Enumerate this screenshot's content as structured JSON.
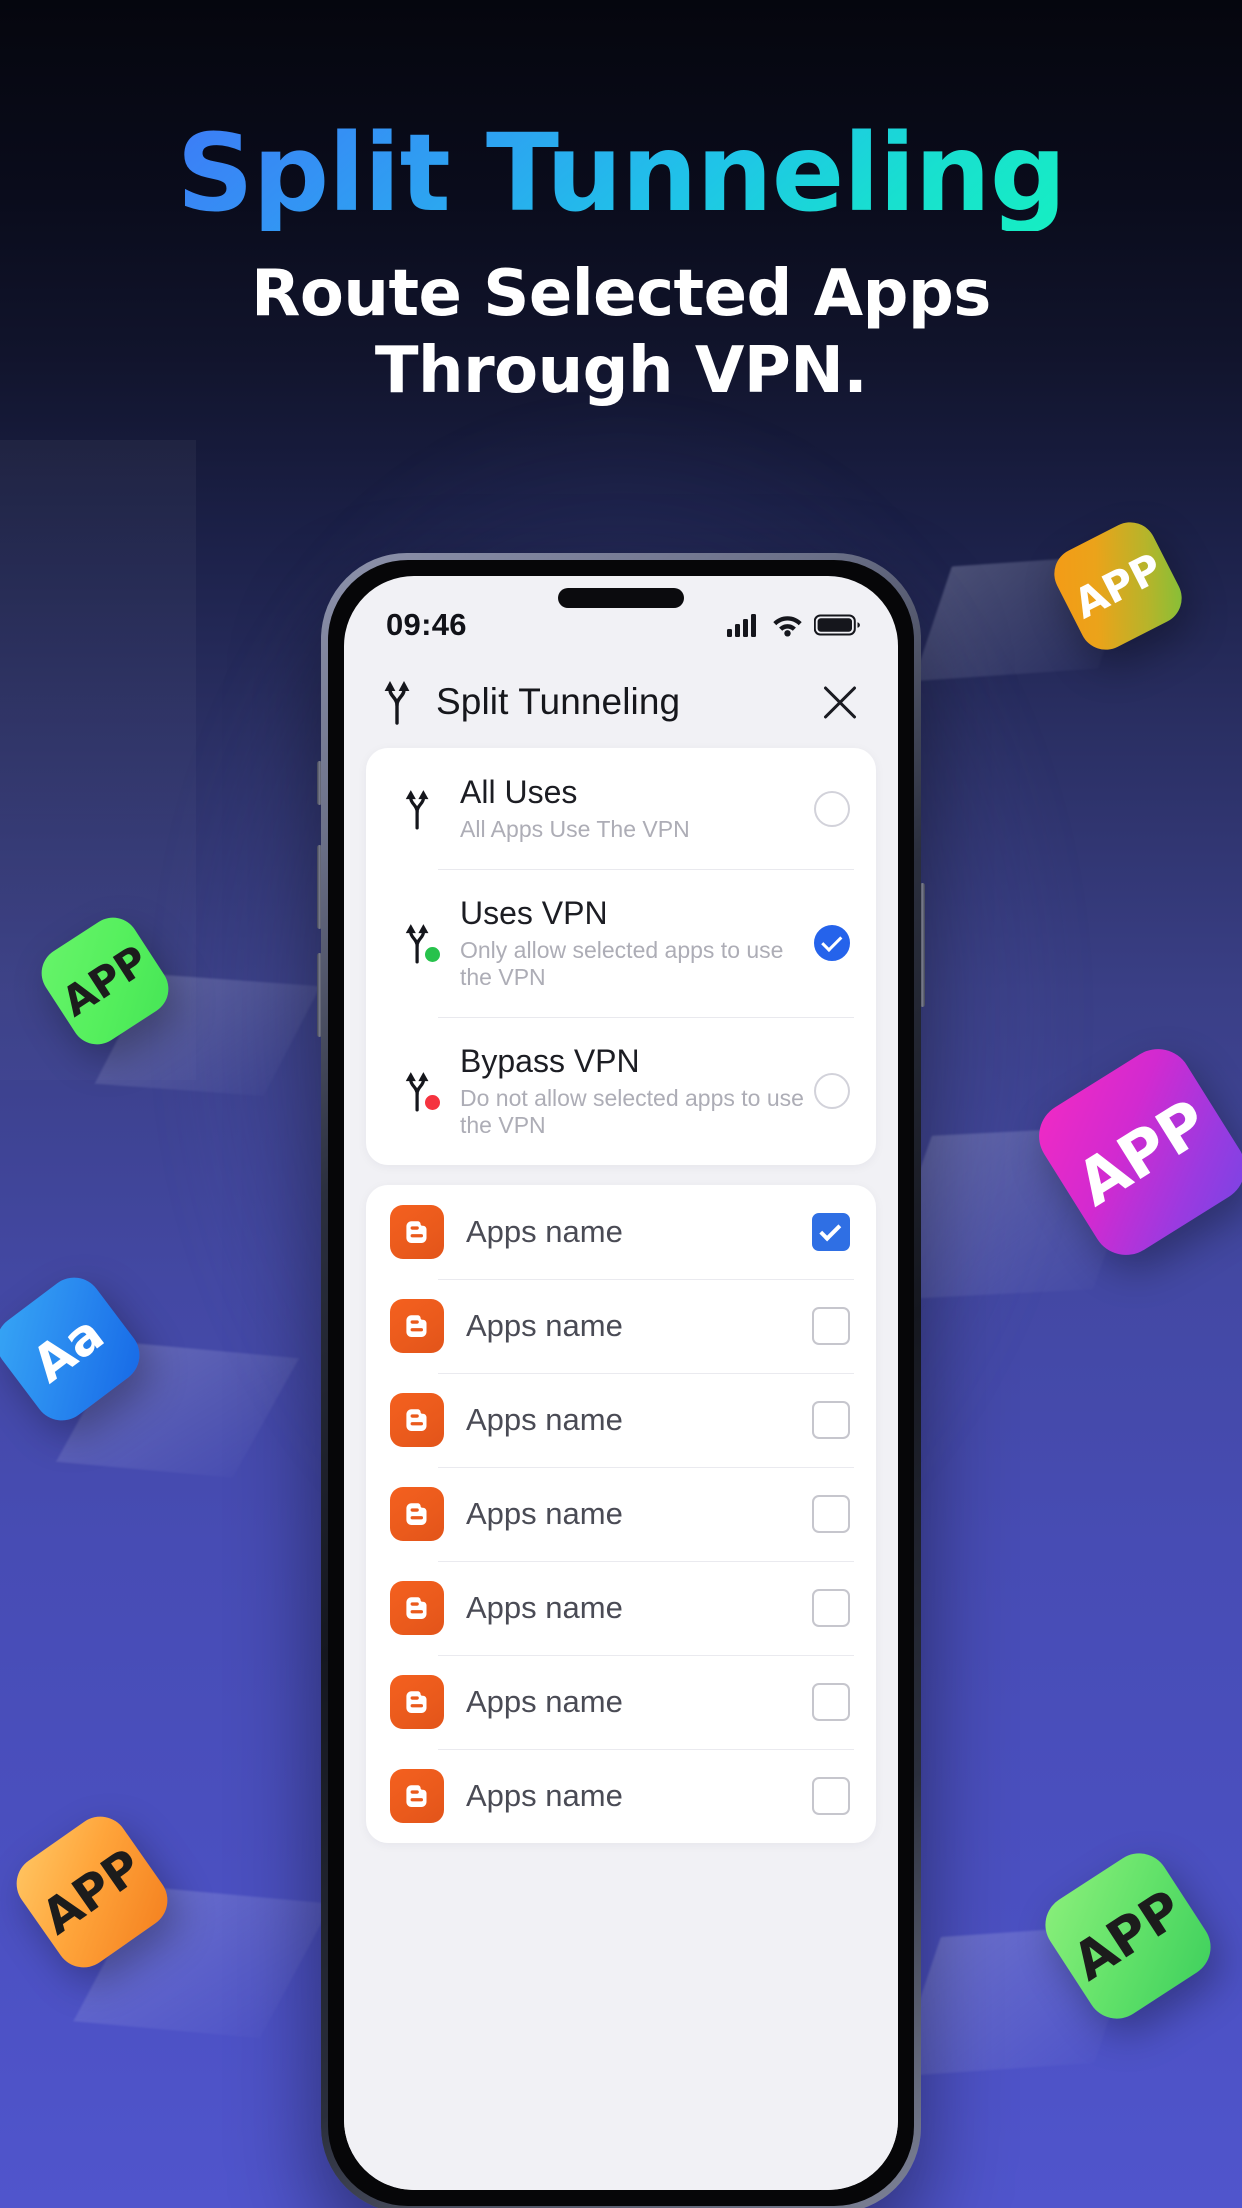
{
  "promo": {
    "title": "Split Tunneling",
    "subtitle_line1": "Route Selected Apps",
    "subtitle_line2": "Through VPN.",
    "title_gradient_from": "#3d7bf7",
    "title_gradient_to": "#16efc2",
    "subtitle_color": "#ffffff"
  },
  "decor_tiles": [
    {
      "label": "APP",
      "name": "floating-tile-orange-green"
    },
    {
      "label": "APP",
      "name": "floating-tile-green-left"
    },
    {
      "label": "Aa",
      "name": "floating-tile-blue-aa"
    },
    {
      "label": "APP",
      "name": "floating-tile-magenta"
    },
    {
      "label": "APP",
      "name": "floating-tile-orange-bottom-left"
    },
    {
      "label": "APP",
      "name": "floating-tile-green-bottom-right"
    }
  ],
  "phone": {
    "status_bar": {
      "time": "09:46",
      "icons": [
        "cellular-signal-icon",
        "wifi-icon",
        "battery-icon"
      ]
    },
    "header": {
      "icon": "split-tunnel-icon",
      "title": "Split Tunneling",
      "close_icon": "close-icon"
    },
    "modes": [
      {
        "title": "All Uses",
        "desc": "All Apps Use The VPN",
        "selected": false,
        "dot": "none"
      },
      {
        "title": "Uses VPN",
        "desc": "Only allow selected apps to use the VPN",
        "selected": true,
        "dot": "#27c24c"
      },
      {
        "title": "Bypass VPN",
        "desc": "Do not allow selected apps to use the VPN",
        "selected": false,
        "dot": "#f5333f"
      }
    ],
    "apps": [
      {
        "name": "Apps name",
        "checked": true
      },
      {
        "name": "Apps name",
        "checked": false
      },
      {
        "name": "Apps name",
        "checked": false
      },
      {
        "name": "Apps name",
        "checked": false
      },
      {
        "name": "Apps name",
        "checked": false
      },
      {
        "name": "Apps name",
        "checked": false
      },
      {
        "name": "Apps name",
        "checked": false
      }
    ],
    "accent_selected": "#2563eb",
    "accent_checkbox": "#2f6fe4"
  }
}
